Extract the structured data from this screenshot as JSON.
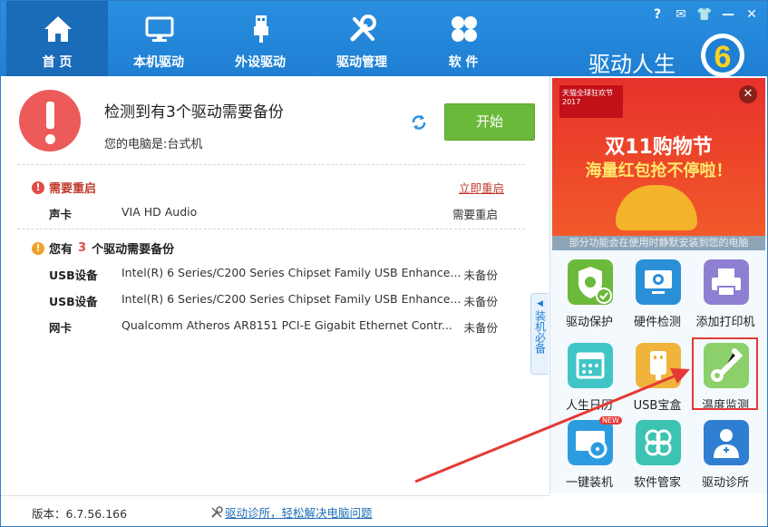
{
  "nav": {
    "tabs": [
      {
        "label": "首 页",
        "icon": "home-icon"
      },
      {
        "label": "本机驱动",
        "icon": "monitor-icon"
      },
      {
        "label": "外设驱动",
        "icon": "usb-icon"
      },
      {
        "label": "驱动管理",
        "icon": "tools-icon"
      },
      {
        "label": "软 件",
        "icon": "apps-icon"
      }
    ],
    "brand": "驱动人生",
    "brand_logo": "6"
  },
  "system_icons": [
    "help-icon",
    "feedback-icon",
    "skin-icon",
    "minimize-icon",
    "close-icon"
  ],
  "alert": {
    "headline": "检测到有3个驱动需要备份",
    "subline": "您的电脑是:台式机",
    "start_label": "开始"
  },
  "restart_section": {
    "title": "需要重启",
    "action": "立即重启",
    "rows": [
      {
        "category": "声卡",
        "device": "VIA HD Audio",
        "status": "需要重启"
      }
    ]
  },
  "backup_section": {
    "title_pre": "您有",
    "count": "3",
    "title_post": "个驱动需要备份",
    "rows": [
      {
        "category": "USB设备",
        "device": "Intel(R) 6 Series/C200 Series Chipset Family USB Enhance...",
        "status": "未备份"
      },
      {
        "category": "USB设备",
        "device": "Intel(R) 6 Series/C200 Series Chipset Family USB Enhance...",
        "status": "未备份"
      },
      {
        "category": "网卡",
        "device": "Qualcomm Atheros AR8151 PCI-E Gigabit Ethernet Contr...",
        "status": "未备份"
      }
    ]
  },
  "sidetab": "装机必备",
  "ad": {
    "tag": "天猫全球狂欢节 2017",
    "line1": "双11购物节",
    "line2": "海量红包抢不停啦！",
    "note": "部分功能会在使用时静默安装到您的电脑"
  },
  "tools": [
    {
      "label": "驱动保护",
      "color": "#6cb93b"
    },
    {
      "label": "硬件检测",
      "color": "#2b8fd8"
    },
    {
      "label": "添加打印机",
      "color": "#8f7fd2"
    },
    {
      "label": "人生日历",
      "color": "#3fc5c5"
    },
    {
      "label": "USB宝盒",
      "color": "#f0b43c"
    },
    {
      "label": "温度监测",
      "color": "#8bd06a"
    },
    {
      "label": "一键装机",
      "color": "#2d9be0"
    },
    {
      "label": "软件管家",
      "color": "#3cc3b2"
    },
    {
      "label": "驱动诊所",
      "color": "#2f7ed1"
    }
  ],
  "new_badge": "NEW",
  "footer": {
    "version": "版本：6.7.56.166",
    "link": "驱动诊所，轻松解决电脑问题"
  }
}
